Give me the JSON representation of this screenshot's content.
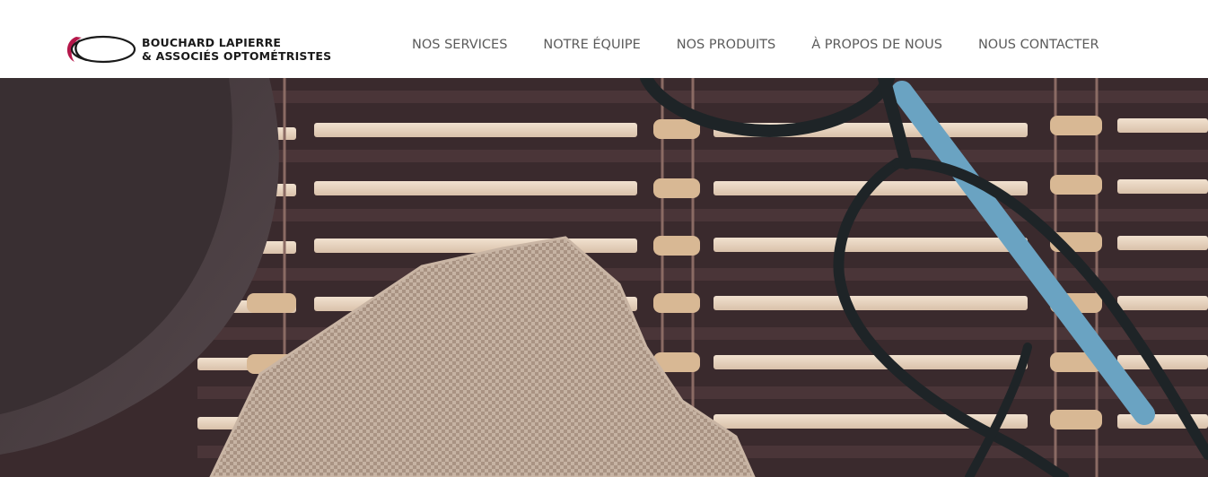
{
  "brand": {
    "name_line1": "BOUCHARD LAPIERRE",
    "name_line2": "& ASSOCIÉS OPTOMÉTRISTES",
    "accent_color": "#b5174a",
    "logo_icon": "eye-ellipse-logo-icon"
  },
  "nav": {
    "items": [
      {
        "label": "NOS SERVICES"
      },
      {
        "label": "NOTRE ÉQUIPE"
      },
      {
        "label": "NOS PRODUITS"
      },
      {
        "label": "À PROPOS DE NOUS"
      },
      {
        "label": "NOUS CONTACTER"
      }
    ],
    "text_color": "#5b5b5b"
  },
  "hero": {
    "image_subject": "eyeglasses-on-bamboo-mat",
    "colors": {
      "mat_dark": "#3a2a2d",
      "mat_slat": "#e9d6c3",
      "burlap": "#b8a495",
      "frame": "#1e2427",
      "temple_blue": "#6aa3c2",
      "bowl": "#4a3f43"
    }
  }
}
